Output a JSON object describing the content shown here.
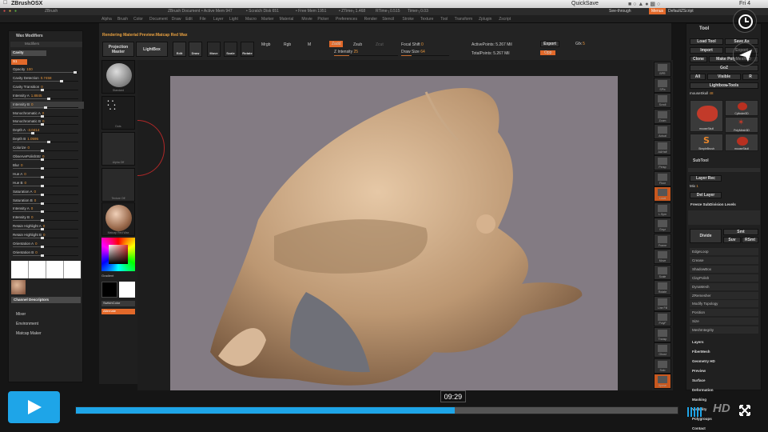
{
  "mac_menubar": {
    "left_items": [
      "ZBrushOSX"
    ],
    "quicksave": "QuickSave",
    "see_through": "See-through",
    "menus": "Menus",
    "default_zscript": "DefaultZScript",
    "clock": "Fri 4"
  },
  "title_bar": {
    "app": "ZBrush",
    "doc": "ZBrush Document",
    "info": [
      "• Active Mem 947",
      "• Scratch Disk 651",
      "• Free Mem 1951",
      "• ZTime┐1.468",
      "RTime┐0.515",
      "Timer┐0.03"
    ]
  },
  "top_menu": {
    "items": [
      "Alpha",
      "Brush",
      "Color",
      "Document",
      "Draw",
      "Edit",
      "File",
      "Layer",
      "Light",
      "Macro",
      "Marker",
      "Material",
      "Movie",
      "Picker",
      "Preferences",
      "Render",
      "Stencil",
      "Stroke",
      "Texture",
      "Tool",
      "Transform",
      "Zplugin",
      "Zscript"
    ]
  },
  "toolbar": {
    "status": "Rendering Material Preview:Matcap Red Wax",
    "projection_master": "Projection Master",
    "lightbox": "LightBox",
    "edit": "Edit",
    "draw": "Draw",
    "move": "Move",
    "scale": "Scale",
    "rotate": "Rotate",
    "mrgb": "Mrgb",
    "rgb": "Rgb",
    "m": "M",
    "zadd": "Zadd",
    "zsub": "Zsub",
    "zcut": "Zcut",
    "z_intensity": "Z Intensity",
    "z_intensity_val": "25",
    "focal_shift": "Focal Shift",
    "focal_shift_val": "0",
    "draw_size": "Draw Size",
    "draw_size_val": "64",
    "active_points": "ActivePoints: 5.267 Mil",
    "total_points": "TotalPoints: 5.267 Mil",
    "export": "Export",
    "gfx": "Gfx",
    "gfx_val": "5",
    "opp": "Opp"
  },
  "left_panel": {
    "section": "Wax Modifiers",
    "subsection": "Modifiers",
    "cavity_btn": "Cavity",
    "s1_val": "S1",
    "rows": [
      {
        "label": "Opacity",
        "value": "100"
      },
      {
        "label": "Cavity Detection",
        "value": "0.7458"
      },
      {
        "label": "Cavity Transition",
        "value": "0"
      },
      {
        "label": "Intensity A",
        "value": "1.8845"
      },
      {
        "label": "Intensity B",
        "value": "0"
      },
      {
        "label": "Monochromatic A",
        "value": "0"
      },
      {
        "label": "Monochromatic B",
        "value": "0"
      },
      {
        "label": "Depth A",
        "value": "-3.0414"
      },
      {
        "label": "Depth B",
        "value": "1.0595"
      },
      {
        "label": "Colorize",
        "value": "0"
      },
      {
        "label": "ObservePolishStr",
        "value": "0"
      },
      {
        "label": "Blur",
        "value": "0"
      },
      {
        "label": "Hue A",
        "value": "0"
      },
      {
        "label": "Hue B",
        "value": "0"
      },
      {
        "label": "Saturation A",
        "value": "0"
      },
      {
        "label": "Saturation B",
        "value": "0"
      },
      {
        "label": "Intensity A",
        "value": "0"
      },
      {
        "label": "Intensity B",
        "value": "0"
      },
      {
        "label": "Retain Highlight A",
        "value": "0"
      },
      {
        "label": "Retain Highlight B",
        "value": "0"
      },
      {
        "label": "Orientation A",
        "value": "0"
      },
      {
        "label": "Orientation B",
        "value": "0"
      }
    ],
    "channel_descriptors": "Channel Descriptors",
    "lower_items": [
      "Mixer",
      "Environment",
      "Matcap Maker"
    ]
  },
  "shelf": {
    "standard": "Standard",
    "dots": "Dots",
    "alpha_off": "Alpha Off",
    "texture_off": "Texture Off",
    "material": "Matcap Red Wax",
    "gradient": "Gradient",
    "switch_color": "SwitchColor",
    "alternate": "Alternate"
  },
  "right_icons": [
    "BPR",
    "SPix",
    "Scroll",
    "Zoom",
    "Actual",
    "AAHalf",
    "Persp",
    "Floor",
    "Local",
    "L.Sym",
    "Gxyz",
    "Frame",
    "Move",
    "Scale",
    "Rotate",
    "Line Fill",
    "PolyF",
    "Transp",
    "Ghost",
    "Solo",
    "Xpose"
  ],
  "tool_panel": {
    "title": "Tool",
    "load_tool": "Load Tool",
    "save_as": "Save As",
    "import": "Import",
    "export": "Export",
    "clone": "Clone",
    "make_polymesh": "Make PolyMesh3D",
    "goz": "GoZ",
    "all": "All",
    "visible": "Visible",
    "r": "R",
    "lightbox_tools": "Lightbox▸Tools",
    "current_tool": "mouseSkull",
    "current_tool_val": "48",
    "thumbs": [
      "mouseSkull",
      "Cylinder3D",
      "PolyMesh3D",
      "SimpleBrush",
      "mouseSkull"
    ],
    "subtool": "SubTool",
    "geometry": "Geometry",
    "layers_label": "Layers",
    "layer_rec": "Layer Rec",
    "mix_label": "Mix",
    "mix_val": "1",
    "del_layer": "Del Layer",
    "freeze_subdiv": "Freeze SubDivision Levels",
    "divide": "Divide",
    "smt": "Smt",
    "suv": "Suv",
    "rsmt": "RSmt",
    "geo_items": [
      "EdgeLoop",
      "Crease",
      "ShadowBox",
      "ClayPolish",
      "DynaMesh",
      "ZRemesher",
      "Modify Topology",
      "Position",
      "Size",
      "MeshIntegrity"
    ],
    "lower": [
      "Layers",
      "FiberMesh",
      "Geometry HD",
      "Preview",
      "Surface",
      "Deformation",
      "Masking",
      "Visibility",
      "Polygroups",
      "Contact"
    ]
  },
  "video_player": {
    "time": "09:29",
    "progress": 0.63,
    "hd": "HD"
  }
}
